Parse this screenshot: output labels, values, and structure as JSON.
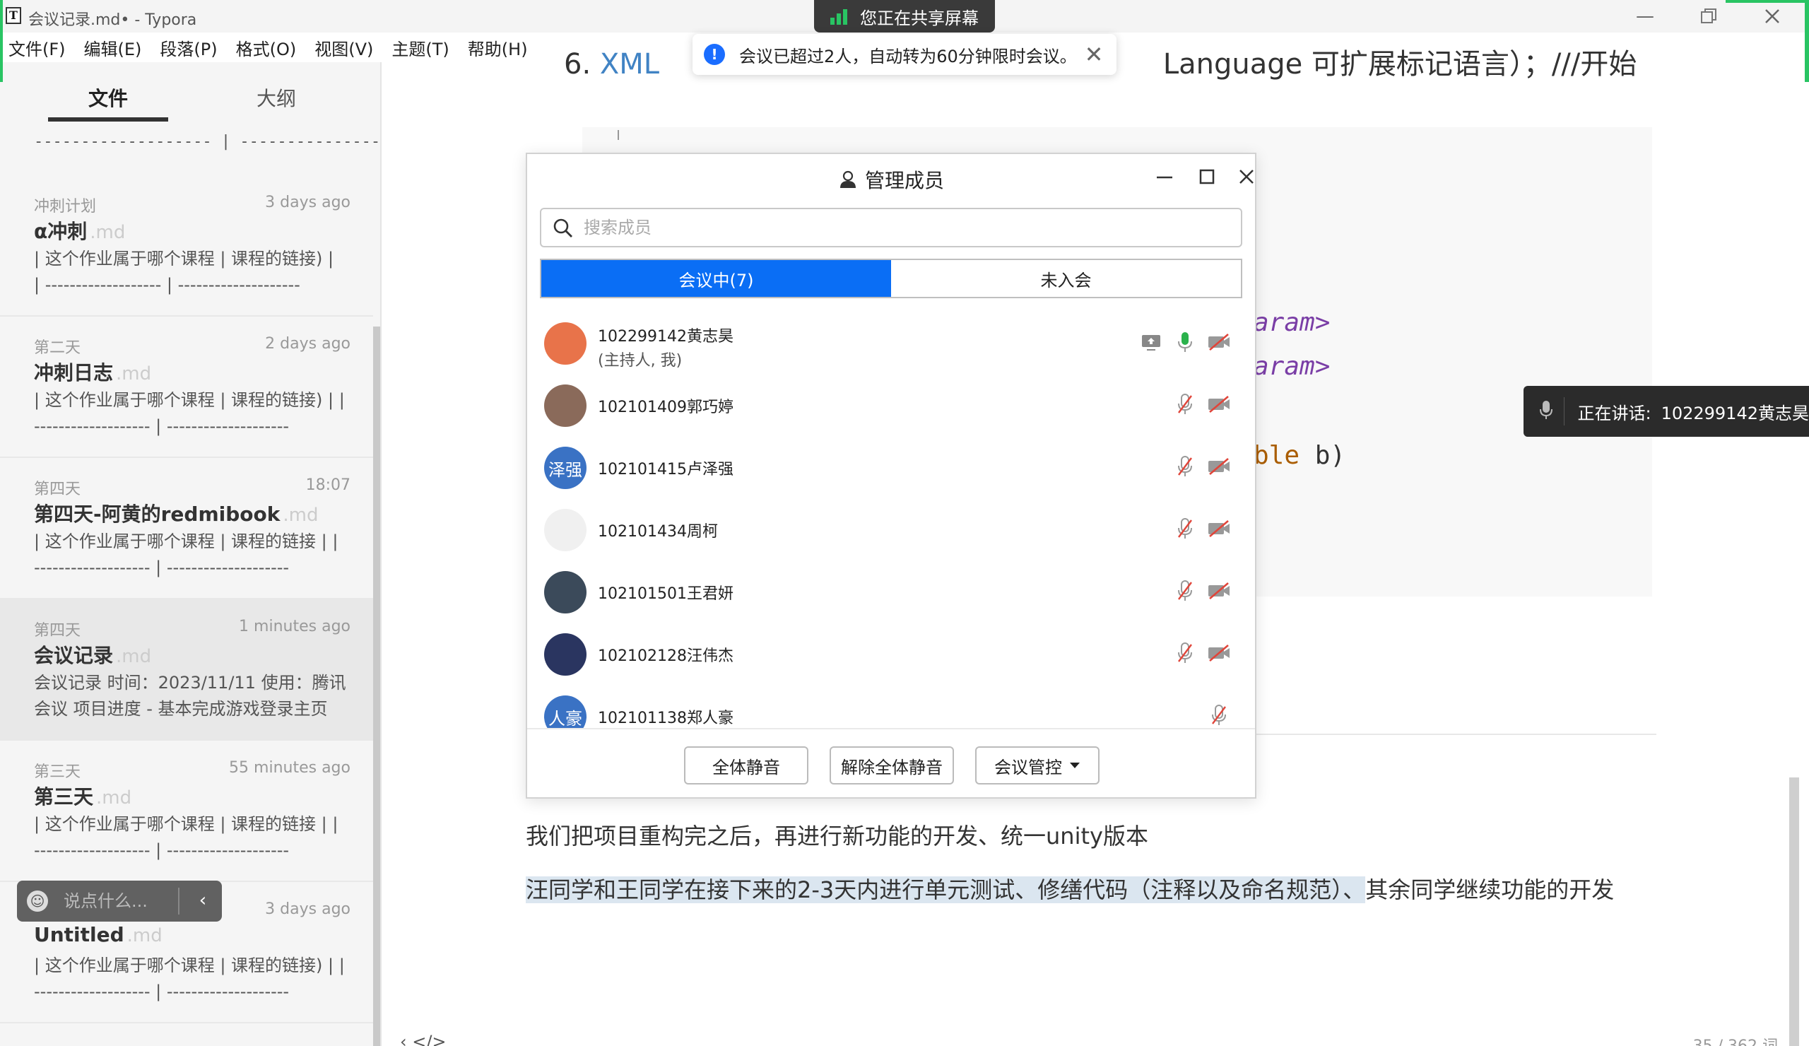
{
  "window": {
    "title": "会议记录.md• - Typora",
    "logo": "T"
  },
  "menu": [
    "文件(F)",
    "编辑(E)",
    "段落(P)",
    "格式(O)",
    "视图(V)",
    "主题(T)",
    "帮助(H)"
  ],
  "sidebar": {
    "tabs": [
      "文件",
      "大纲"
    ],
    "active_tab": "文件",
    "top_dashes": "------------------- | --------------------",
    "files": [
      {
        "folder": "冲刺计划",
        "time": "3 days ago",
        "title": "α冲刺",
        "ext": ".md",
        "excerpt": "| 这个作业属于哪个课程 | 课程的链接) |\n| ------------------- | --------------------"
      },
      {
        "folder": "第二天",
        "time": "2 days ago",
        "title": "冲刺日志",
        "ext": ".md",
        "excerpt": "| 这个作业属于哪个课程 | 课程的链接) | |\n------------------- | --------------------"
      },
      {
        "folder": "第四天",
        "time": "18:07",
        "title": "第四天-阿黄的redmibook",
        "ext": ".md",
        "excerpt": "| 这个作业属于哪个课程 | 课程的链接 | |\n------------------- | --------------------"
      },
      {
        "folder": "第四天",
        "time": "1 minutes ago",
        "title": "会议记录",
        "ext": ".md",
        "excerpt": "会议记录 时间：2023/11/11 使用：腾讯\n会议 项目进度 - 基本完成游戏登录主页"
      },
      {
        "folder": "第三天",
        "time": "55 minutes ago",
        "title": "第三天",
        "ext": ".md",
        "excerpt": "| 这个作业属于哪个课程 | 课程的链接 | |\n------------------- | --------------------"
      },
      {
        "folder": "",
        "time": "3 days ago",
        "title": "Untitled",
        "ext": ".md",
        "excerpt": "| 这个作业属于哪个课程 | 课程的链接) | |\n------------------- | --------------------"
      }
    ]
  },
  "chat": {
    "placeholder": "说点什么...",
    "collapse": "‹"
  },
  "screen_share": {
    "label": "您正在共享屏幕"
  },
  "notification": {
    "text": "会议已超过2人，自动转为60分钟限时会议。"
  },
  "speaking": {
    "label": "正在讲话:",
    "name": "102299142黄志昊"
  },
  "editor": {
    "heading_num": "6.",
    "heading_link": "XML",
    "heading_rest": "Language 可扩展标记语言）；///开始",
    "code": {
      "line1_kw": "aram>",
      "line2_kw": "aram>",
      "line3_type": "ble",
      "line3_rest": " b)"
    },
    "para1": "我们把项目重构完之后，再进行新功能的开发、统一unity版本",
    "para2_highlight": "汪同学和王同学在接下来的2-3天内进行单元测试、修缮代码（注释以及命名规范）、",
    "para2_rest": "其余同学继续功能的开发",
    "footer_left": "‹     </>",
    "word_count": "35 / 362 词"
  },
  "dialog": {
    "title": "管理成员",
    "search_placeholder": "搜索成员",
    "tabs": [
      "会议中(7)",
      "未入会"
    ],
    "active_tab": "会议中(7)",
    "members": [
      {
        "name": "102299142黄志昊",
        "role": "(主持人, 我)",
        "avatar_text": "",
        "avatar_color": "#e8734a",
        "share": true,
        "mic": "on",
        "cam": "off"
      },
      {
        "name": "102101409郭巧婷",
        "role": "",
        "avatar_text": "",
        "avatar_color": "#8a6a5a",
        "share": false,
        "mic": "off",
        "cam": "off"
      },
      {
        "name": "102101415卢泽强",
        "role": "",
        "avatar_text": "泽强",
        "avatar_color": "#3a72c4",
        "share": false,
        "mic": "off",
        "cam": "off"
      },
      {
        "name": "102101434周柯",
        "role": "",
        "avatar_text": "",
        "avatar_color": "#f0f0f0",
        "share": false,
        "mic": "off",
        "cam": "off"
      },
      {
        "name": "102101501王君妍",
        "role": "",
        "avatar_text": "",
        "avatar_color": "#3b4a5a",
        "share": false,
        "mic": "off",
        "cam": "off"
      },
      {
        "name": "102102128汪伟杰",
        "role": "",
        "avatar_text": "",
        "avatar_color": "#2a3560",
        "share": false,
        "mic": "off",
        "cam": "off"
      },
      {
        "name": "102101138郑人豪",
        "role": "",
        "avatar_text": "人豪",
        "avatar_color": "#3a72c4",
        "share": false,
        "mic": "off",
        "cam": "none"
      }
    ],
    "buttons": [
      "全体静音",
      "解除全体静音",
      "会议管控"
    ],
    "colors": {
      "accent": "#0a6ef5",
      "mic_on": "#2bb24c",
      "muted": "#e0453a"
    }
  }
}
